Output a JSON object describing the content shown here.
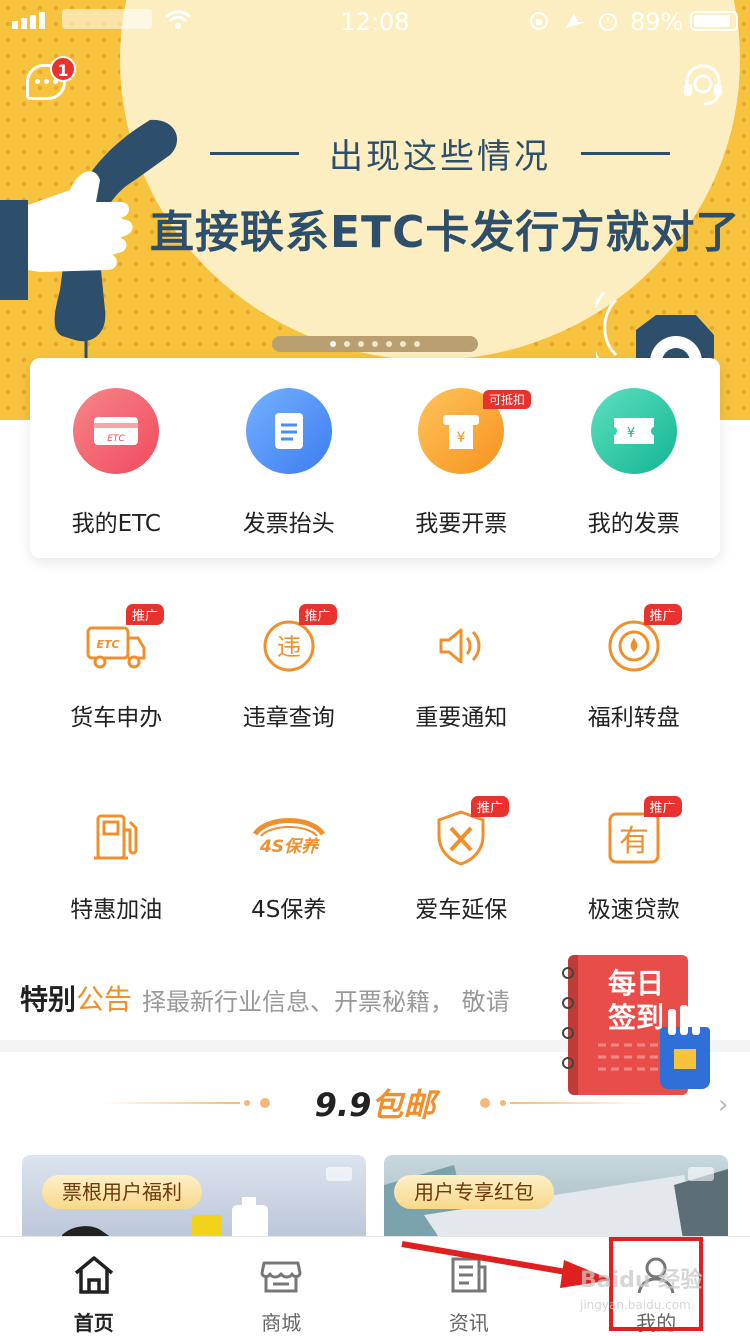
{
  "status_bar": {
    "time": "12:08",
    "battery": "89%"
  },
  "header": {
    "message_badge": "1"
  },
  "banner": {
    "subtitle": "出现这些情况",
    "title": "直接联系ETC卡发行方就对了",
    "page_count": 7,
    "active_page": 1
  },
  "main_card": {
    "items": [
      {
        "label": "我的ETC",
        "icon": "etc-card-icon",
        "color": "#f05a6a"
      },
      {
        "label": "发票抬头",
        "icon": "document-icon",
        "color": "#4a8ff5"
      },
      {
        "label": "我要开票",
        "icon": "invoice-print-icon",
        "color": "#f8a42a",
        "tag": "可抵扣"
      },
      {
        "label": "我的发票",
        "icon": "ticket-icon",
        "color": "#1fc6a6"
      }
    ]
  },
  "grid": {
    "rows": [
      [
        {
          "label": "货车申办",
          "icon": "truck-etc-icon",
          "promo": "推广"
        },
        {
          "label": "违章查询",
          "icon": "violation-icon",
          "promo": "推广"
        },
        {
          "label": "重要通知",
          "icon": "speaker-icon"
        },
        {
          "label": "福利转盘",
          "icon": "wheel-icon",
          "promo": "推广"
        }
      ],
      [
        {
          "label": "特惠加油",
          "icon": "fuel-pump-icon"
        },
        {
          "label": "4S保养",
          "icon": "maintenance-4s-icon"
        },
        {
          "label": "爱车延保",
          "icon": "shield-tools-icon",
          "promo": "推广"
        },
        {
          "label": "极速贷款",
          "icon": "loan-icon",
          "promo": "推广"
        }
      ]
    ]
  },
  "notice": {
    "tag_a": "特别",
    "tag_b": "公告",
    "text": "择最新行业信息、开票秘籍， 敬请"
  },
  "signin": {
    "label": "每日签到"
  },
  "section": {
    "title_a": "9.9",
    "title_b": "包邮"
  },
  "products": [
    {
      "label": "票根用户福利"
    },
    {
      "label": "用户专享红包"
    }
  ],
  "tabbar": {
    "tabs": [
      {
        "label": "首页",
        "icon": "home-icon",
        "active": true
      },
      {
        "label": "商城",
        "icon": "store-icon"
      },
      {
        "label": "资讯",
        "icon": "news-icon"
      },
      {
        "label": "我的",
        "icon": "user-icon"
      }
    ]
  },
  "watermark": {
    "main": "Baidu 经验",
    "sub": "jingyan.baidu.com"
  },
  "colors": {
    "accent": "#f0902d",
    "alert": "#e8322e",
    "banner": "#f7c33f",
    "banner_text": "#2d4f6b"
  }
}
